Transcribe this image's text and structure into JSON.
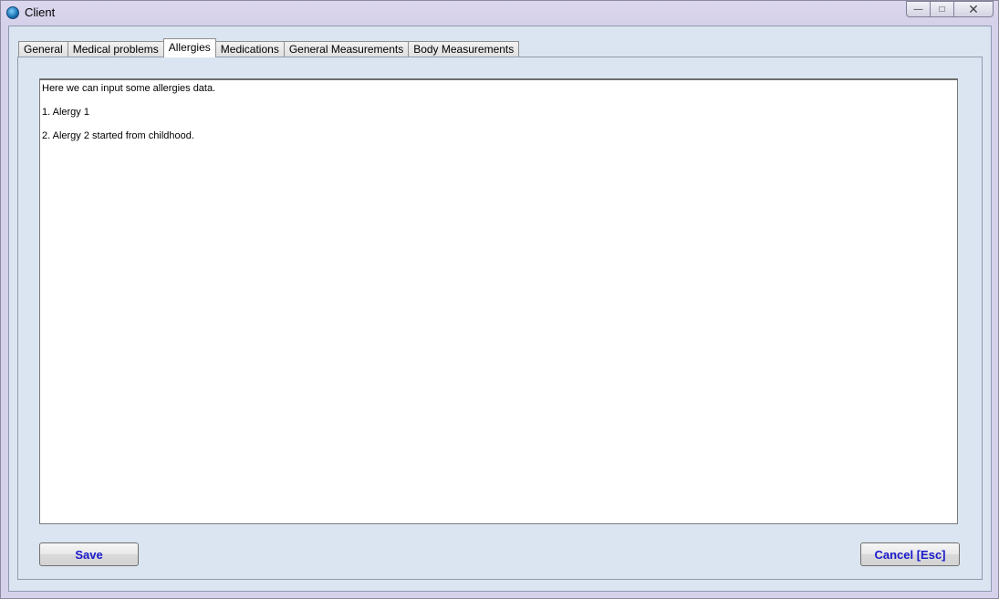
{
  "window": {
    "title": "Client",
    "icon": "app-globe-icon",
    "controls": {
      "minimize": "—",
      "maximize": "□",
      "close": "✕"
    }
  },
  "tabs": [
    {
      "label": "General",
      "active": false
    },
    {
      "label": "Medical problems",
      "active": false
    },
    {
      "label": "Allergies",
      "active": true
    },
    {
      "label": "Medications",
      "active": false
    },
    {
      "label": "General Measurements",
      "active": false
    },
    {
      "label": "Body Measurements",
      "active": false
    }
  ],
  "allergies": {
    "lines": [
      "Here we can input some allergies data.",
      "1. Alergy 1",
      "2. Alergy 2 started from childhood."
    ]
  },
  "buttons": {
    "save": "Save",
    "cancel": "Cancel [Esc]"
  },
  "colors": {
    "button_text": "#1a1acc",
    "panel_background": "#dbe5f1"
  }
}
